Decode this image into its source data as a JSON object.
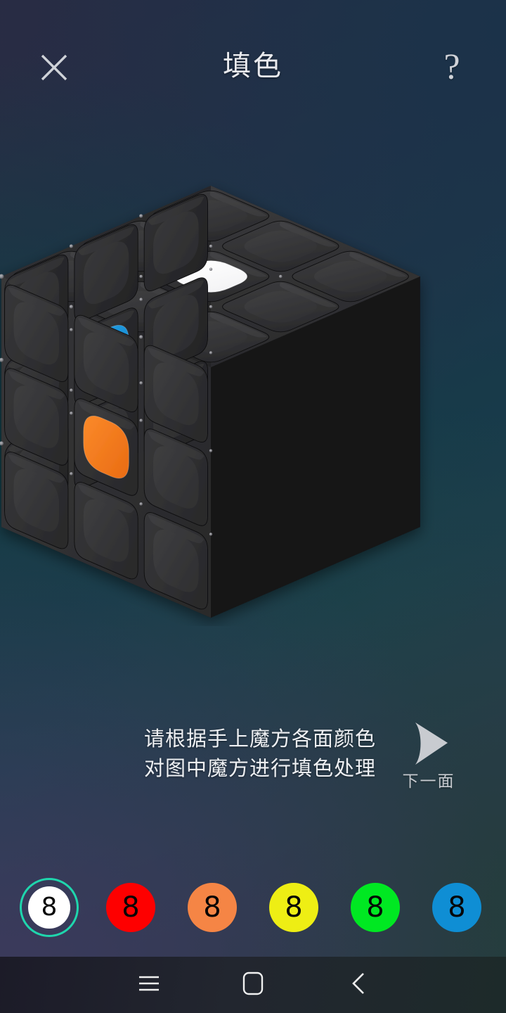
{
  "app": {
    "screen_title": "填色"
  },
  "header": {
    "close_icon": "close-icon",
    "help_label": "?",
    "help_icon": "question-mark-icon"
  },
  "cube": {
    "type": "3x3x3-rubiks-cube",
    "body_color": "#2f2f31",
    "gap_color": "#121214",
    "unfilled_sticker_color": "#38383a",
    "faces": {
      "top": {
        "name": "up-face",
        "stickers": [
          "#38383a",
          "#38383a",
          "#38383a",
          "#38383a",
          "#ffffff",
          "#38383a",
          "#38383a",
          "#38383a",
          "#38383a"
        ],
        "center_color": "#ffffff",
        "center_color_name": "white"
      },
      "left": {
        "name": "front-left-face",
        "stickers": [
          "#38383a",
          "#38383a",
          "#38383a",
          "#38383a",
          "#1b96dc",
          "#38383a",
          "#38383a",
          "#38383a",
          "#38383a"
        ],
        "center_color": "#1b96dc",
        "center_color_name": "blue"
      },
      "right": {
        "name": "front-right-face",
        "stickers": [
          "#38383a",
          "#38383a",
          "#38383a",
          "#38383a",
          "#f57a20",
          "#38383a",
          "#38383a",
          "#38383a",
          "#38383a"
        ],
        "center_color": "#f57a20",
        "center_color_name": "orange"
      }
    }
  },
  "instructions": {
    "line1": "请根据手上魔方各面颜色",
    "line2": "对图中魔方进行填色处理"
  },
  "next_face_button": {
    "label": "下一面",
    "icon": "play-arrow-icon",
    "icon_color": "#c8cbd0"
  },
  "palette": {
    "selected_index": 0,
    "selection_ring_color": "#1fd6ad",
    "swatches": [
      {
        "name": "white",
        "color": "#ffffff",
        "count": "8",
        "selected": true
      },
      {
        "name": "red",
        "color": "#fe0000",
        "count": "8",
        "selected": false
      },
      {
        "name": "orange",
        "color": "#f58545",
        "count": "8",
        "selected": false
      },
      {
        "name": "yellow",
        "color": "#eeee14",
        "count": "8",
        "selected": false
      },
      {
        "name": "green",
        "color": "#00e822",
        "count": "8",
        "selected": false
      },
      {
        "name": "blue",
        "color": "#0f8ed4",
        "count": "8",
        "selected": false
      }
    ]
  },
  "navbar": {
    "menu_icon": "hamburger-menu-icon",
    "home_icon": "home-rounded-square-icon",
    "back_icon": "back-chevron-icon"
  }
}
